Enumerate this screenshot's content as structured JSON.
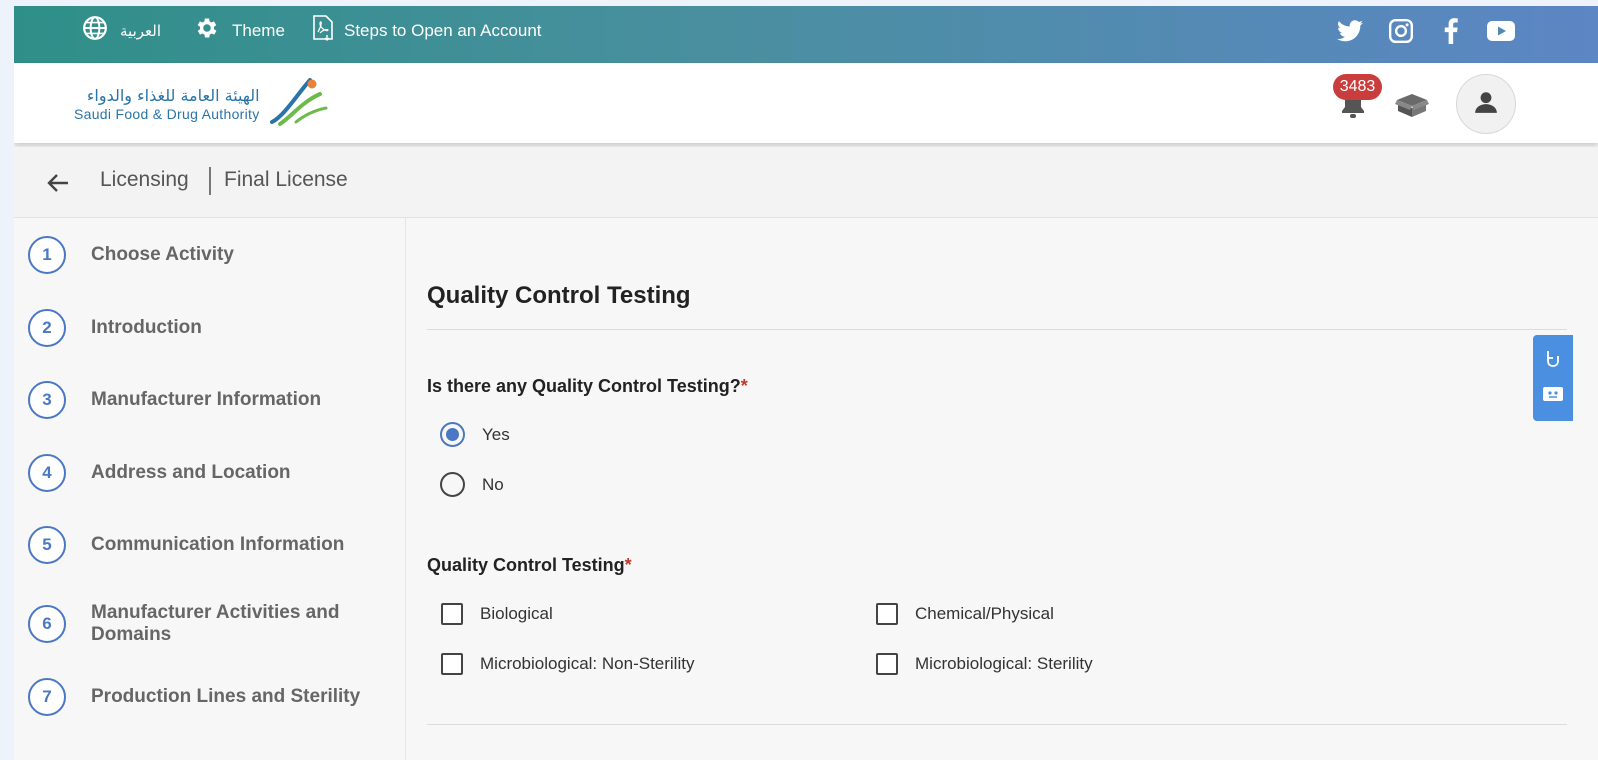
{
  "topbar": {
    "language_label": "العربية",
    "theme_label": "Theme",
    "steps_label": "Steps to Open an Account",
    "social": [
      "twitter-icon",
      "instagram-icon",
      "facebook-icon",
      "youtube-icon"
    ]
  },
  "header": {
    "logo_ar": "الهيئة العامة للغذاء والدواء",
    "logo_en": "Saudi Food & Drug Authority",
    "notification_count": "3483"
  },
  "breadcrumb": {
    "items": [
      "Licensing",
      "Final License"
    ]
  },
  "sidebar": {
    "steps": [
      {
        "num": "1",
        "label": "Choose Activity"
      },
      {
        "num": "2",
        "label": "Introduction"
      },
      {
        "num": "3",
        "label": "Manufacturer Information"
      },
      {
        "num": "4",
        "label": "Address and Location"
      },
      {
        "num": "5",
        "label": "Communication Information"
      },
      {
        "num": "6",
        "label": "Manufacturer Activities and Domains"
      },
      {
        "num": "7",
        "label": "Production Lines and Sterility"
      }
    ]
  },
  "main": {
    "section_title": "Quality Control Testing",
    "question": "Is there any Quality Control Testing?",
    "required_mark": "*",
    "options": [
      {
        "label": "Yes",
        "selected": true
      },
      {
        "label": "No",
        "selected": false
      }
    ],
    "testing_label": "Quality Control Testing",
    "checkboxes": [
      {
        "label": "Biological",
        "checked": false
      },
      {
        "label": "Chemical/Physical",
        "checked": false
      },
      {
        "label": "Microbiological: Non-Sterility",
        "checked": false
      },
      {
        "label": "Microbiological: Sterility",
        "checked": false
      }
    ]
  },
  "colors": {
    "accent": "#4a78c4",
    "badge": "#c93d3d",
    "topbar_start": "#2f8f88",
    "topbar_end": "#5c86c4"
  }
}
